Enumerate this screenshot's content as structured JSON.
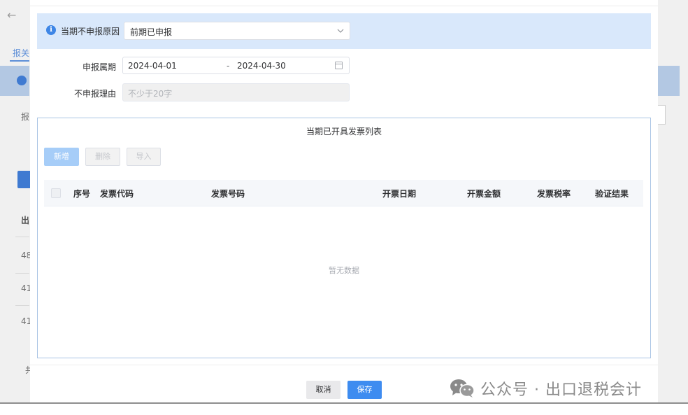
{
  "background": {
    "back_arrow": "←",
    "tab_label": "报关",
    "label_row": "报",
    "list_col": "出",
    "rows": [
      "48",
      "41",
      "41"
    ],
    "bottom_label": "共"
  },
  "modal": {
    "reason": {
      "label": "当期不申报原因",
      "value": "前期已申报"
    },
    "period": {
      "label": "申报属期",
      "start": "2024-04-01",
      "separator": "-",
      "end": "2024-04-30"
    },
    "reason_text": {
      "label": "不申报理由",
      "placeholder": "不少于20字"
    },
    "invoice_list": {
      "title": "当期已开具发票列表",
      "buttons": {
        "add": "新增",
        "delete": "删除",
        "import": "导入"
      },
      "columns": [
        "序号",
        "发票代码",
        "发票号码",
        "开票日期",
        "开票金额",
        "发票税率",
        "验证结果"
      ],
      "empty_text": "暂无数据"
    },
    "footer": {
      "cancel": "取消",
      "save": "保存"
    }
  },
  "watermark": {
    "text": "公众号 · 出口退税会计",
    "icon": "wechat-icon"
  },
  "colors": {
    "primary": "#3e8cf0",
    "info_bar": "#d9e8fb",
    "panel_border": "#a9c4e4"
  }
}
